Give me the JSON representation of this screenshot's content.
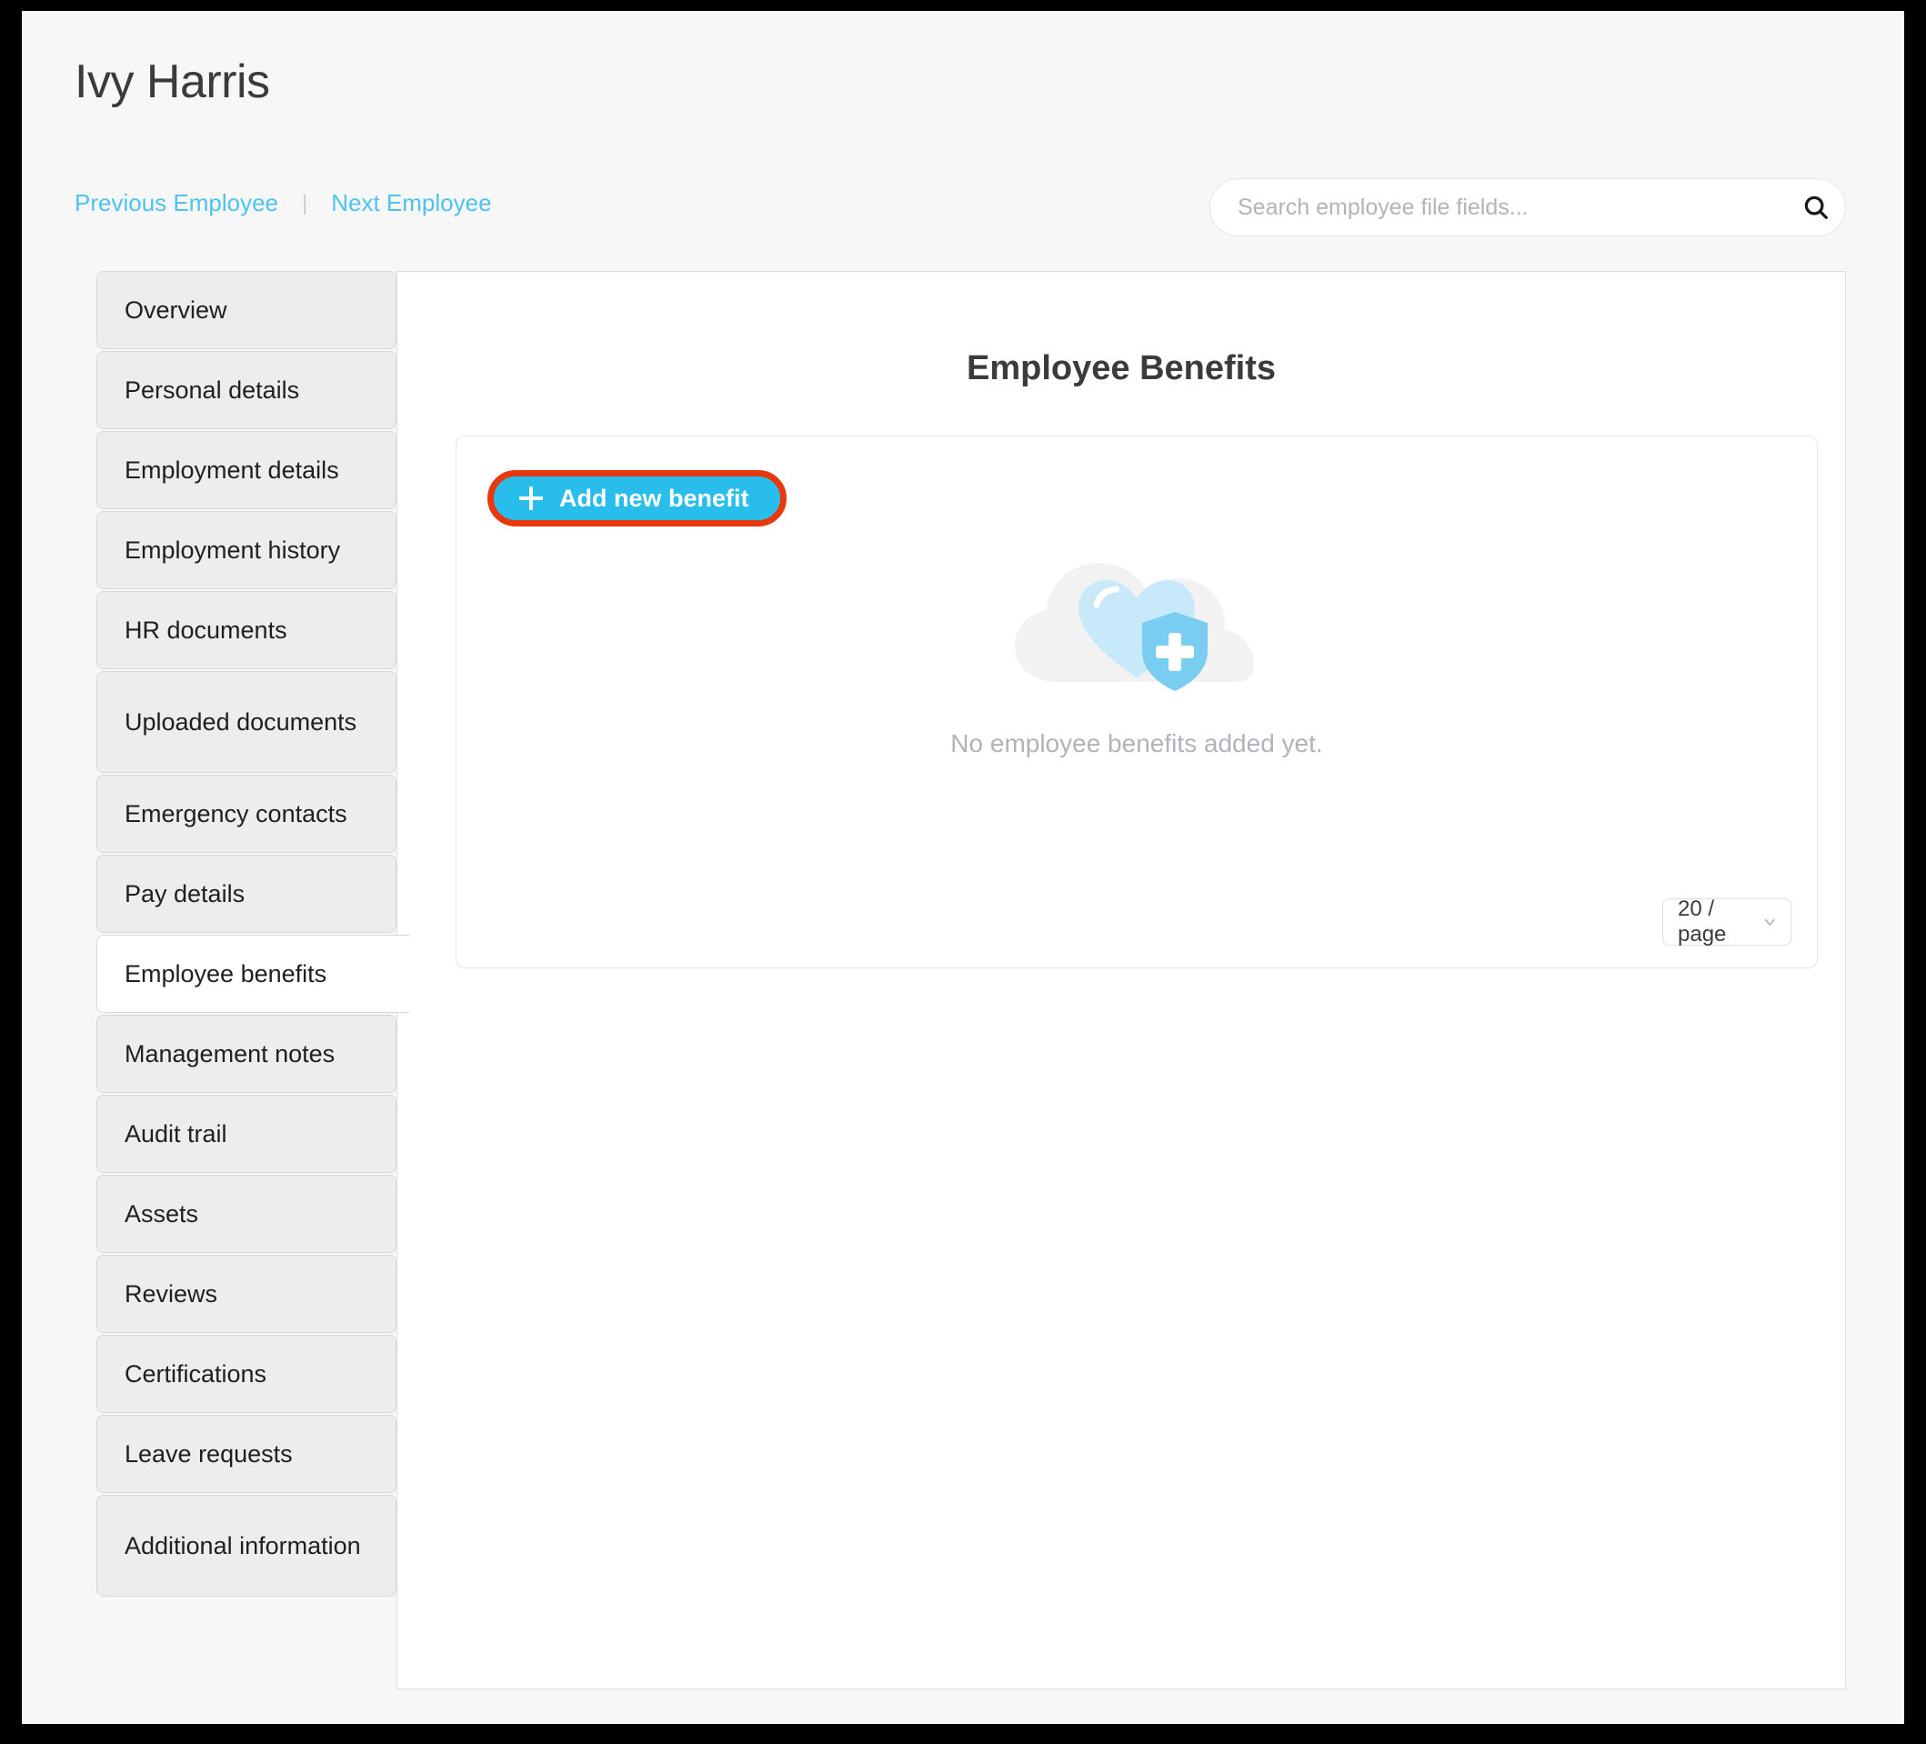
{
  "header": {
    "employee_name": "Ivy Harris",
    "previous_employee_label": "Previous Employee",
    "next_employee_label": "Next Employee",
    "separator": "|"
  },
  "search": {
    "placeholder": "Search employee file fields...",
    "value": "",
    "icon": "search-icon"
  },
  "sidebar": {
    "items": [
      {
        "label": "Overview",
        "active": false
      },
      {
        "label": "Personal details",
        "active": false
      },
      {
        "label": "Employment details",
        "active": false
      },
      {
        "label": "Employment history",
        "active": false
      },
      {
        "label": "HR documents",
        "active": false
      },
      {
        "label": "Uploaded documents",
        "active": false
      },
      {
        "label": "Emergency contacts",
        "active": false
      },
      {
        "label": "Pay details",
        "active": false
      },
      {
        "label": "Employee benefits",
        "active": true
      },
      {
        "label": "Management notes",
        "active": false
      },
      {
        "label": "Audit trail",
        "active": false
      },
      {
        "label": "Assets",
        "active": false
      },
      {
        "label": "Reviews",
        "active": false
      },
      {
        "label": "Certifications",
        "active": false
      },
      {
        "label": "Leave requests",
        "active": false
      },
      {
        "label": "Additional information",
        "active": false
      }
    ]
  },
  "main": {
    "section_title": "Employee Benefits",
    "add_benefit_label": "Add new benefit",
    "add_benefit_icon": "plus-icon",
    "empty_state_text": "No employee benefits added yet.",
    "empty_state_icon": "heart-shield-plus-illustration",
    "page_size_value": "20 / page",
    "page_size_icon": "chevron-down-icon"
  },
  "colors": {
    "accent_blue": "#29bdeb",
    "link_blue": "#4ec3f0",
    "highlight_red": "#e8380d",
    "page_background": "#f7f7f7",
    "tab_background": "#ededed",
    "muted_text": "#b0b3bb",
    "heart_light": "#c8e9f9",
    "shield_blue": "#79cdf0",
    "cloud_gray": "#f2f2f2"
  }
}
